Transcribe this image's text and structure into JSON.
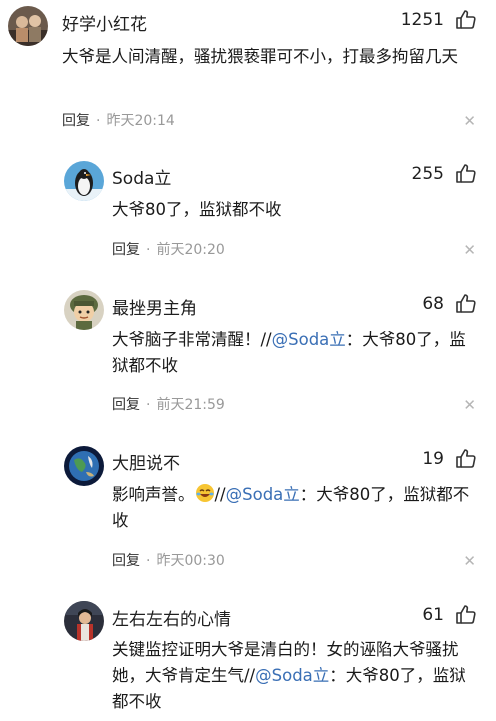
{
  "comments": [
    {
      "username": "好学小红花",
      "likes": "1251",
      "text": "大爷是人间清醒，骚扰猥亵罪可不小，打最多拘留几天",
      "reply_label": "回复",
      "time": "昨天20:14"
    },
    {
      "username": "Soda立",
      "likes": "255",
      "text": "大爷80了，监狱都不收",
      "reply_label": "回复",
      "time": "前天20:20"
    },
    {
      "username": "最挫男主角",
      "likes": "68",
      "text_before": "大爷脑子非常清醒！//",
      "mention": "@Soda立",
      "text_after": "：大爷80了，监狱都不收",
      "reply_label": "回复",
      "time": "前天21:59"
    },
    {
      "username": "大胆说不",
      "likes": "19",
      "text_before": "影响声誉。",
      "text_mid": "//",
      "mention": "@Soda立",
      "text_after": "：大爷80了，监狱都不收",
      "reply_label": "回复",
      "time": "昨天00:30"
    },
    {
      "username": "左右左右的心情",
      "likes": "61",
      "text_before": "关键监控证明大爷是清白的！女的诬陷大爷骚扰她，大爷肯定生气//",
      "mention": "@Soda立",
      "text_after": "：大爷80了，监狱都不收"
    }
  ],
  "icons": {
    "like": "thumbs-up-icon",
    "close": "close-icon",
    "emoji": "laughing-tears-emoji"
  },
  "colors": {
    "mention": "#3a6fb5",
    "meta_time": "#999999"
  }
}
